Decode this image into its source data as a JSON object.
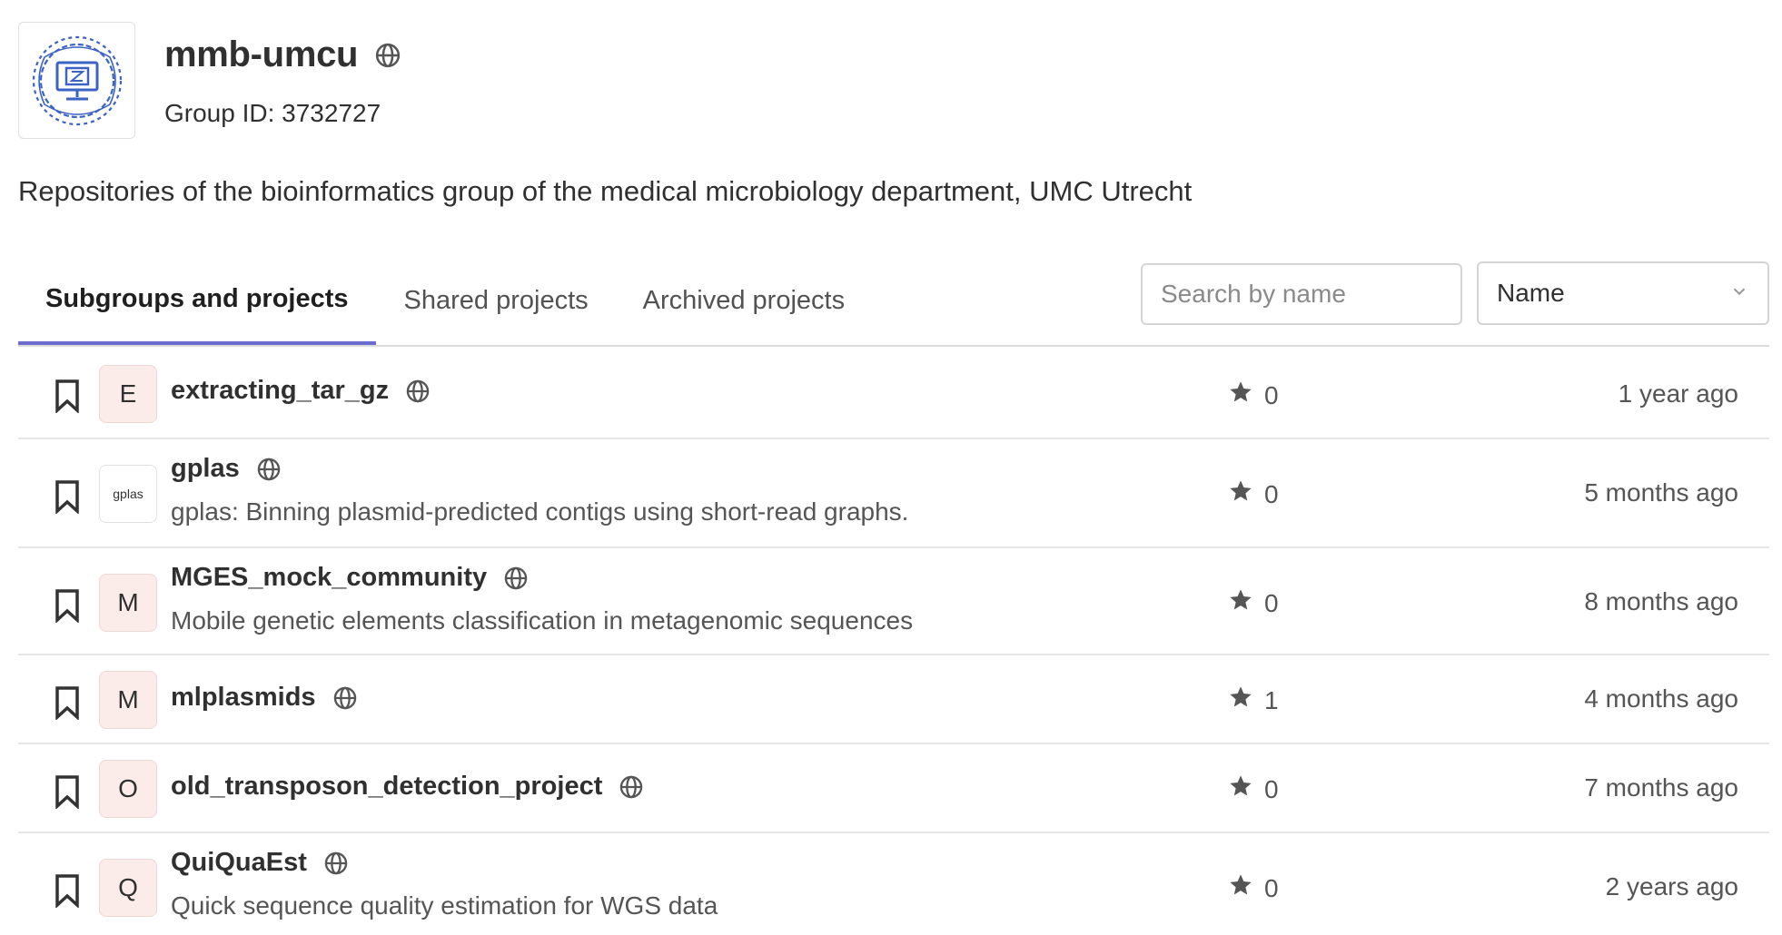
{
  "group": {
    "name": "mmb-umcu",
    "id_text": "Group ID: 3732727",
    "description": "Repositories of the bioinformatics group of the medical microbiology department, UMC Utrecht",
    "visibility_icon": "globe-icon"
  },
  "tabs": [
    {
      "label": "Subgroups and projects",
      "active": true
    },
    {
      "label": "Shared projects",
      "active": false
    },
    {
      "label": "Archived projects",
      "active": false
    }
  ],
  "search": {
    "placeholder": "Search by name",
    "value": ""
  },
  "sort": {
    "selected": "Name",
    "icon": "chevron-down-icon"
  },
  "projects": [
    {
      "avatar_letter": "E",
      "name": "extracting_tar_gz",
      "description": "",
      "stars": "0",
      "updated": "1 year ago"
    },
    {
      "avatar_letter": "",
      "avatar_logo_text": "gplas",
      "name": "gplas",
      "description": "gplas: Binning plasmid-predicted contigs using short-read graphs.",
      "stars": "0",
      "updated": "5 months ago"
    },
    {
      "avatar_letter": "M",
      "name": "MGES_mock_community",
      "description": "Mobile genetic elements classification in metagenomic sequences",
      "stars": "0",
      "updated": "8 months ago"
    },
    {
      "avatar_letter": "M",
      "name": "mlplasmids",
      "description": "",
      "stars": "1",
      "updated": "4 months ago"
    },
    {
      "avatar_letter": "O",
      "name": "old_transposon_detection_project",
      "description": "",
      "stars": "0",
      "updated": "7 months ago"
    },
    {
      "avatar_letter": "Q",
      "name": "QuiQuaEst",
      "description": "Quick sequence quality estimation for WGS data",
      "stars": "0",
      "updated": "2 years ago"
    }
  ],
  "colors": {
    "active_tab_underline": "#6b6bd0",
    "avatar_bg": "#fbece9",
    "logo_blue": "#3a63c4"
  }
}
